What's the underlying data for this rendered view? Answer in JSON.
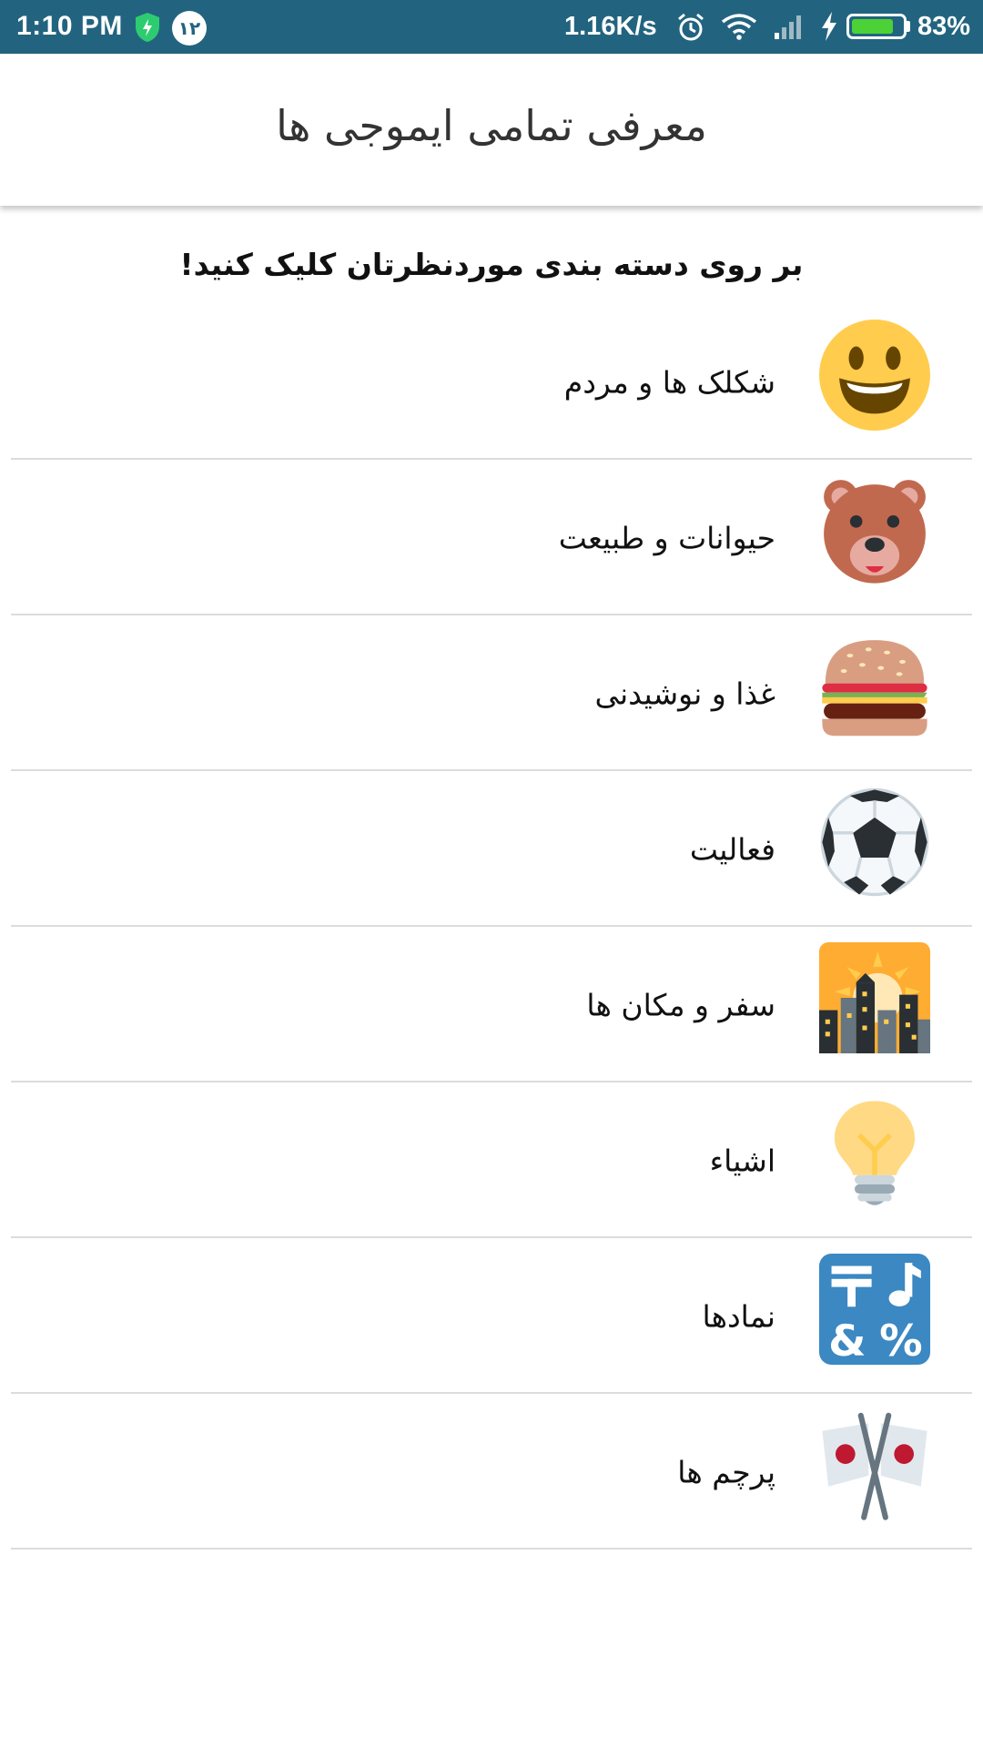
{
  "status_bar": {
    "time": "1:10 PM",
    "notification_badge": "۱۲",
    "net_speed": "1.16K/s",
    "battery_percent": "83%",
    "battery_level": 0.83,
    "icons": [
      "shield-icon",
      "alarm-icon",
      "wifi-icon",
      "signal-icon",
      "charging-bolt-icon",
      "battery-icon"
    ]
  },
  "app_bar": {
    "title": "معرفی تمامی ایموجی ها"
  },
  "instruction": "بر روی دسته بندی موردنظرتان کلیک کنید!",
  "categories": [
    {
      "label": "شکلک ها و مردم",
      "icon": "smiley-face-icon"
    },
    {
      "label": "حیوانات و طبیعت",
      "icon": "bear-face-icon"
    },
    {
      "label": "غذا و نوشیدنی",
      "icon": "hamburger-icon"
    },
    {
      "label": "فعالیت",
      "icon": "soccer-ball-icon"
    },
    {
      "label": "سفر و مکان ها",
      "icon": "cityscape-sunset-icon"
    },
    {
      "label": "اشیاء",
      "icon": "light-bulb-icon"
    },
    {
      "label": "نمادها",
      "icon": "symbols-icon"
    },
    {
      "label": "پرچم ها",
      "icon": "crossed-flags-icon"
    }
  ],
  "colors": {
    "status_bar_bg": "#22647f",
    "divider": "#dcdcdc",
    "battery_fill": "#4cd137"
  }
}
